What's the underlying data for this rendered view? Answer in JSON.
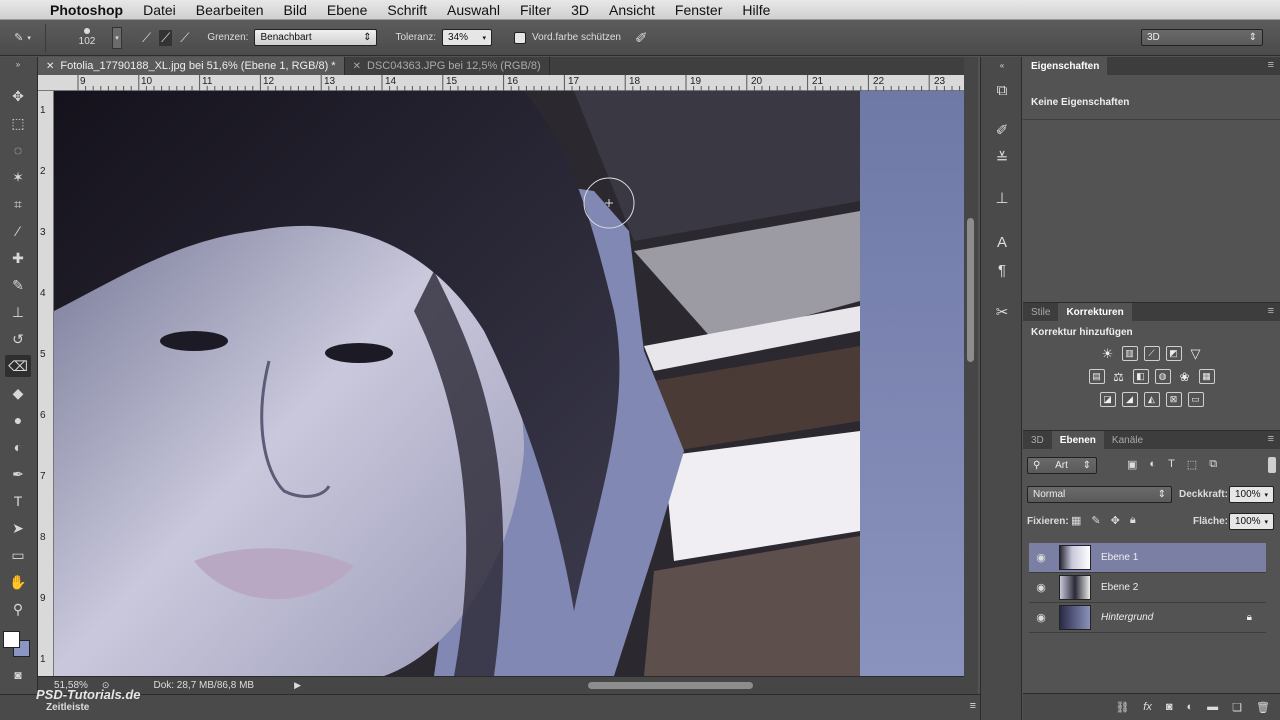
{
  "menubar": {
    "apple": "",
    "app": "Photoshop",
    "items": [
      "Datei",
      "Bearbeiten",
      "Bild",
      "Ebene",
      "Schrift",
      "Auswahl",
      "Filter",
      "3D",
      "Ansicht",
      "Fenster",
      "Hilfe"
    ]
  },
  "options": {
    "brush_size": "102",
    "grenzen_label": "Grenzen:",
    "grenzen_value": "Benachbart",
    "toleranz_label": "Toleranz:",
    "toleranz_value": "34%",
    "vord_label": "Vord.farbe schützen",
    "workspace": "3D"
  },
  "tabs": [
    {
      "label": "Fotolia_17790188_XL.jpg bei 51,6% (Ebene 1, RGB/8) *",
      "active": true
    },
    {
      "label": "DSC04363.JPG bei 12,5% (RGB/8)",
      "active": false
    }
  ],
  "ruler": {
    "h": [
      "9",
      "10",
      "11",
      "12",
      "13",
      "14",
      "15",
      "16",
      "17",
      "18",
      "19",
      "20",
      "21",
      "22",
      "23"
    ],
    "v": [
      "1",
      "2",
      "3",
      "4",
      "5",
      "6",
      "7",
      "8",
      "9",
      "1"
    ]
  },
  "status": {
    "zoom": "51,58%",
    "doc": "Dok: 28,7 MB/86,8 MB"
  },
  "timeline": {
    "label": "Zeitleiste",
    "watermark": "PSD-Tutorials.de"
  },
  "properties": {
    "tab": "Eigenschaften",
    "empty": "Keine Eigenschaften"
  },
  "adjust": {
    "tabs": [
      "Stile",
      "Korrekturen"
    ],
    "heading": "Korrektur hinzufügen"
  },
  "layers": {
    "tabs": [
      "3D",
      "Ebenen",
      "Kanäle"
    ],
    "filter": "Art",
    "blend": "Normal",
    "opacity_label": "Deckkraft:",
    "opacity": "100%",
    "lock_label": "Fixieren:",
    "fill_label": "Fläche:",
    "fill": "100%",
    "items": [
      {
        "name": "Ebene 1",
        "selected": true
      },
      {
        "name": "Ebene 2",
        "selected": false
      },
      {
        "name": "Hintergrund",
        "selected": false,
        "locked": true
      }
    ]
  }
}
